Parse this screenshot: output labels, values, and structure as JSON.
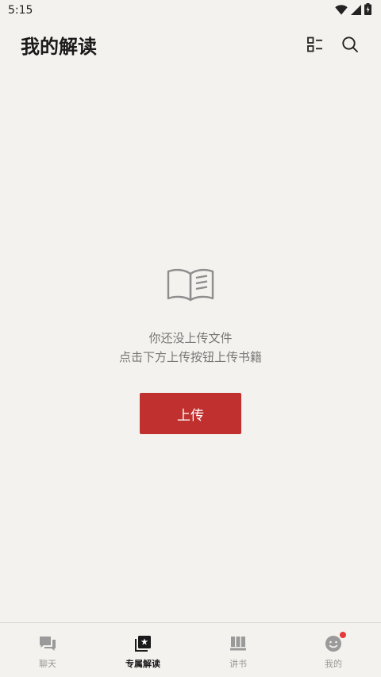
{
  "status_bar": {
    "time": "5:15",
    "icons": [
      "wifi-icon",
      "signal-icon",
      "battery-charging-icon"
    ]
  },
  "header": {
    "title": "我的解读",
    "actions": [
      "list-view-icon",
      "search-icon"
    ]
  },
  "empty_state": {
    "icon": "open-book-icon",
    "line1": "你还没上传文件",
    "line2": "点击下方上传按钮上传书籍",
    "button_label": "上传"
  },
  "bottom_nav": {
    "items": [
      {
        "label": "聊天",
        "icon": "chat-icon",
        "active": false
      },
      {
        "label": "专属解读",
        "icon": "star-book-icon",
        "active": true
      },
      {
        "label": "讲书",
        "icon": "books-icon",
        "active": false
      },
      {
        "label": "我的",
        "icon": "profile-icon",
        "active": false,
        "badge": true
      }
    ]
  },
  "colors": {
    "accent": "#c0302e",
    "background": "#f3f2ee",
    "badge": "#e5393a"
  }
}
